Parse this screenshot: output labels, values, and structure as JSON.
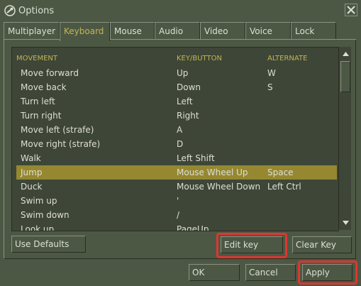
{
  "window": {
    "title": "Options",
    "close_icon": "close-icon",
    "app_icon": "steam-icon"
  },
  "tabs": [
    {
      "label": "Multiplayer"
    },
    {
      "label": "Keyboard",
      "active": true
    },
    {
      "label": "Mouse"
    },
    {
      "label": "Audio"
    },
    {
      "label": "Video"
    },
    {
      "label": "Voice"
    },
    {
      "label": "Lock"
    }
  ],
  "table": {
    "columns": [
      "MOVEMENT",
      "KEY/BUTTON",
      "ALTERNATE"
    ],
    "rows": [
      {
        "action": "Move forward",
        "key": "Up",
        "alt": "W"
      },
      {
        "action": "Move back",
        "key": "Down",
        "alt": "S"
      },
      {
        "action": "Turn left",
        "key": "Left",
        "alt": ""
      },
      {
        "action": "Turn right",
        "key": "Right",
        "alt": ""
      },
      {
        "action": "Move left (strafe)",
        "key": "A",
        "alt": ""
      },
      {
        "action": "Move right (strafe)",
        "key": "D",
        "alt": ""
      },
      {
        "action": "Walk",
        "key": "Left Shift",
        "alt": ""
      },
      {
        "action": "Jump",
        "key": "Mouse Wheel Up",
        "alt": "Space",
        "selected": true
      },
      {
        "action": "Duck",
        "key": "Mouse Wheel Down",
        "alt": "Left Ctrl"
      },
      {
        "action": "Swim up",
        "key": "'",
        "alt": ""
      },
      {
        "action": "Swim down",
        "key": "/",
        "alt": ""
      },
      {
        "action": "Look up",
        "key": "PageUp",
        "alt": ""
      }
    ]
  },
  "buttons": {
    "use_defaults": "Use Defaults",
    "edit_key": "Edit key",
    "clear_key": "Clear Key",
    "ok": "OK",
    "cancel": "Cancel",
    "apply": "Apply"
  },
  "colors": {
    "background": "#4c5844",
    "list_background": "#3e4637",
    "selected_row": "#958831",
    "accent_text": "#c4b550",
    "highlight_box": "#e0352f"
  }
}
